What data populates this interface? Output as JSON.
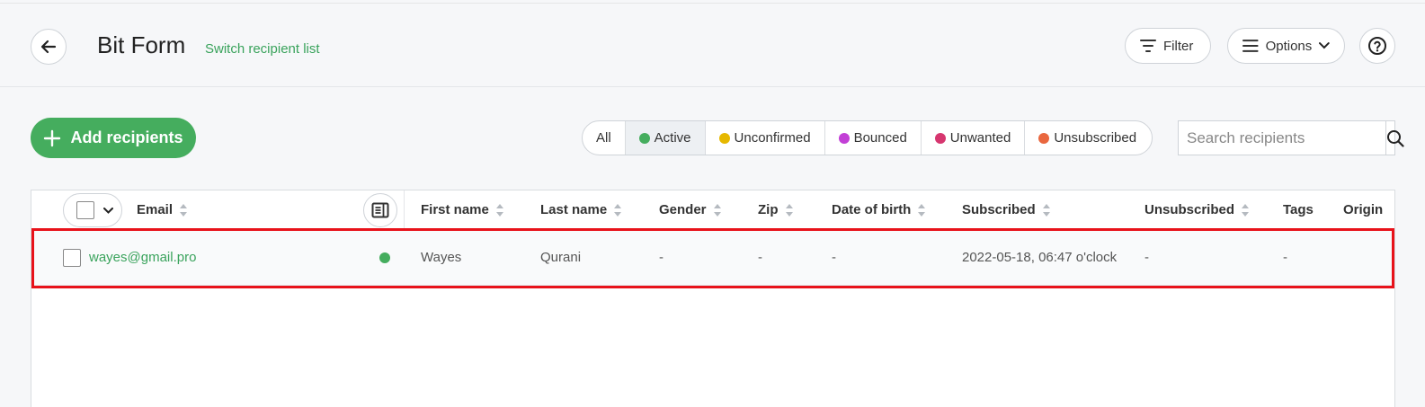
{
  "header": {
    "title": "Bit Form",
    "switch_link": "Switch recipient list",
    "filter_label": "Filter",
    "options_label": "Options"
  },
  "toolbar": {
    "add_label": "Add recipients",
    "search_placeholder": "Search recipients"
  },
  "segments": [
    {
      "label": "All",
      "color": null,
      "active": false
    },
    {
      "label": "Active",
      "color": "#45ad5e",
      "active": true
    },
    {
      "label": "Unconfirmed",
      "color": "#e6b800",
      "active": false
    },
    {
      "label": "Bounced",
      "color": "#c23fd6",
      "active": false
    },
    {
      "label": "Unwanted",
      "color": "#d6366f",
      "active": false
    },
    {
      "label": "Unsubscribed",
      "color": "#e9673f",
      "active": false
    }
  ],
  "table": {
    "columns": {
      "email": "Email",
      "first_name": "First name",
      "last_name": "Last name",
      "gender": "Gender",
      "zip": "Zip",
      "dob": "Date of birth",
      "subscribed": "Subscribed",
      "unsubscribed": "Unsubscribed",
      "tags": "Tags",
      "origin": "Origin"
    },
    "rows": [
      {
        "email": "wayes@gmail.pro",
        "status_color": "#45ad5e",
        "first_name": "Wayes",
        "last_name": "Qurani",
        "gender": "-",
        "zip": "-",
        "dob": "-",
        "subscribed": "2022-05-18, 06:47 o'clock",
        "unsubscribed": "-",
        "tags": "-"
      }
    ]
  },
  "colors": {
    "accent": "#45ad5e",
    "highlight": "#e8121a"
  }
}
